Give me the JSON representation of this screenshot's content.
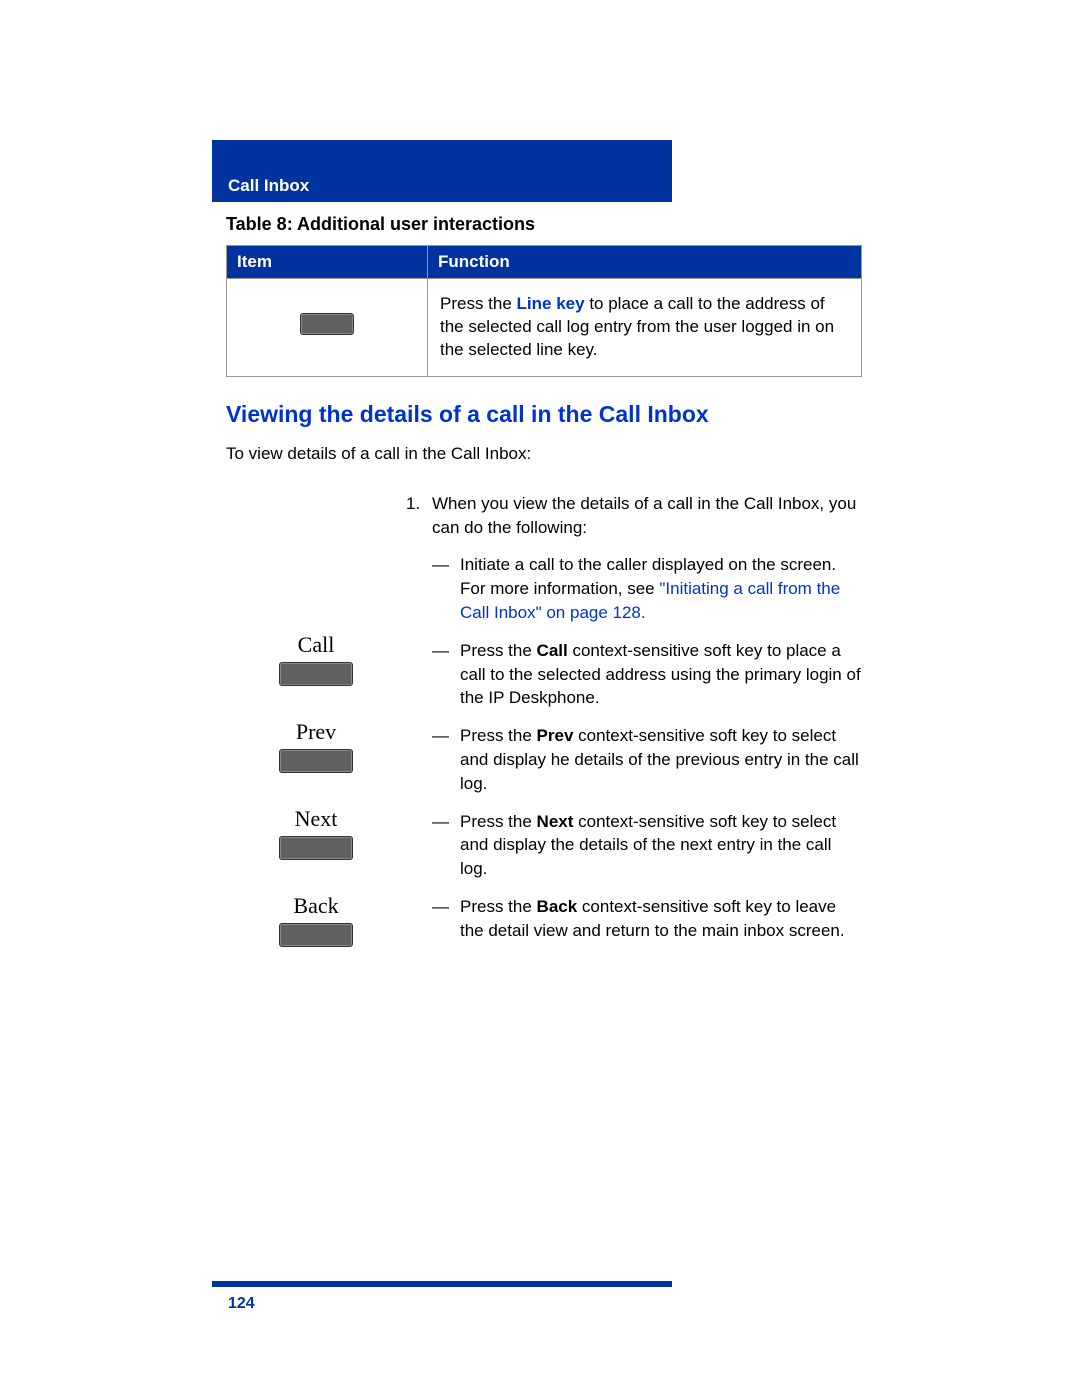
{
  "header": {
    "section": "Call Inbox"
  },
  "table": {
    "caption": "Table 8: Additional user interactions",
    "col_item": "Item",
    "col_function": "Function",
    "row1_pre": "Press the ",
    "row1_link": "Line key",
    "row1_post": " to place a call to the address of the selected call log entry from the user logged in on the selected line key."
  },
  "heading": "Viewing the details of a call in the Call Inbox",
  "intro": "To view details of a call in the Call Inbox:",
  "softkeys": {
    "call": "Call",
    "prev": "Prev",
    "next": "Next",
    "back": "Back"
  },
  "step": {
    "num": "1.",
    "lead": "When you view the details of a call in the Call Inbox, you can do the following:",
    "b1_pre": "Initiate a call to the caller displayed on the screen. For more information, see ",
    "b1_link": "\"Initiating a call from the Call Inbox\" on page 128.",
    "b2_pre": "Press the ",
    "b2_kw": "Call",
    "b2_post": " context-sensitive soft key to place a call to the selected address using the primary login of the IP Deskphone.",
    "b3_pre": "Press the ",
    "b3_kw": "Prev",
    "b3_post": " context-sensitive soft key to select and display he details of the previous entry in the call log.",
    "b4_pre": "Press the ",
    "b4_kw": "Next",
    "b4_post": " context-sensitive soft key to select and display the details of the next entry in the call log.",
    "b5_pre": "Press the ",
    "b5_kw": "Back",
    "b5_post": " context-sensitive soft key to leave the detail view and return to the main inbox screen."
  },
  "page_number": "124"
}
